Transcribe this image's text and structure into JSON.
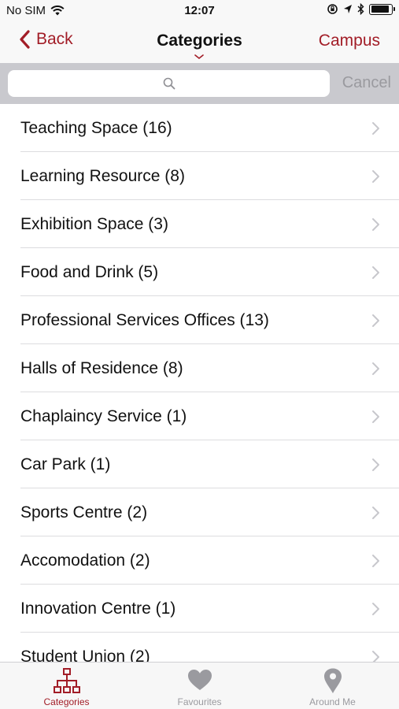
{
  "status_bar": {
    "carrier": "No SIM",
    "time": "12:07"
  },
  "nav": {
    "back_label": "Back",
    "title": "Categories",
    "right_label": "Campus"
  },
  "search": {
    "placeholder": "",
    "cancel_label": "Cancel"
  },
  "categories": [
    {
      "label": "Teaching Space (16)"
    },
    {
      "label": "Learning Resource (8)"
    },
    {
      "label": "Exhibition Space (3)"
    },
    {
      "label": "Food and Drink (5)"
    },
    {
      "label": "Professional Services Offices (13)"
    },
    {
      "label": "Halls of Residence (8)"
    },
    {
      "label": "Chaplaincy Service (1)"
    },
    {
      "label": "Car Park (1)"
    },
    {
      "label": "Sports Centre (2)"
    },
    {
      "label": "Accomodation (2)"
    },
    {
      "label": "Innovation Centre (1)"
    },
    {
      "label": "Student Union (2)"
    }
  ],
  "tabs": [
    {
      "label": "Categories",
      "icon": "hierarchy-icon",
      "active": true
    },
    {
      "label": "Favourites",
      "icon": "heart-icon",
      "active": false
    },
    {
      "label": "Around Me",
      "icon": "map-pin-icon",
      "active": false
    }
  ],
  "colors": {
    "accent": "#a21d27",
    "inactive": "#9a9a9f"
  }
}
